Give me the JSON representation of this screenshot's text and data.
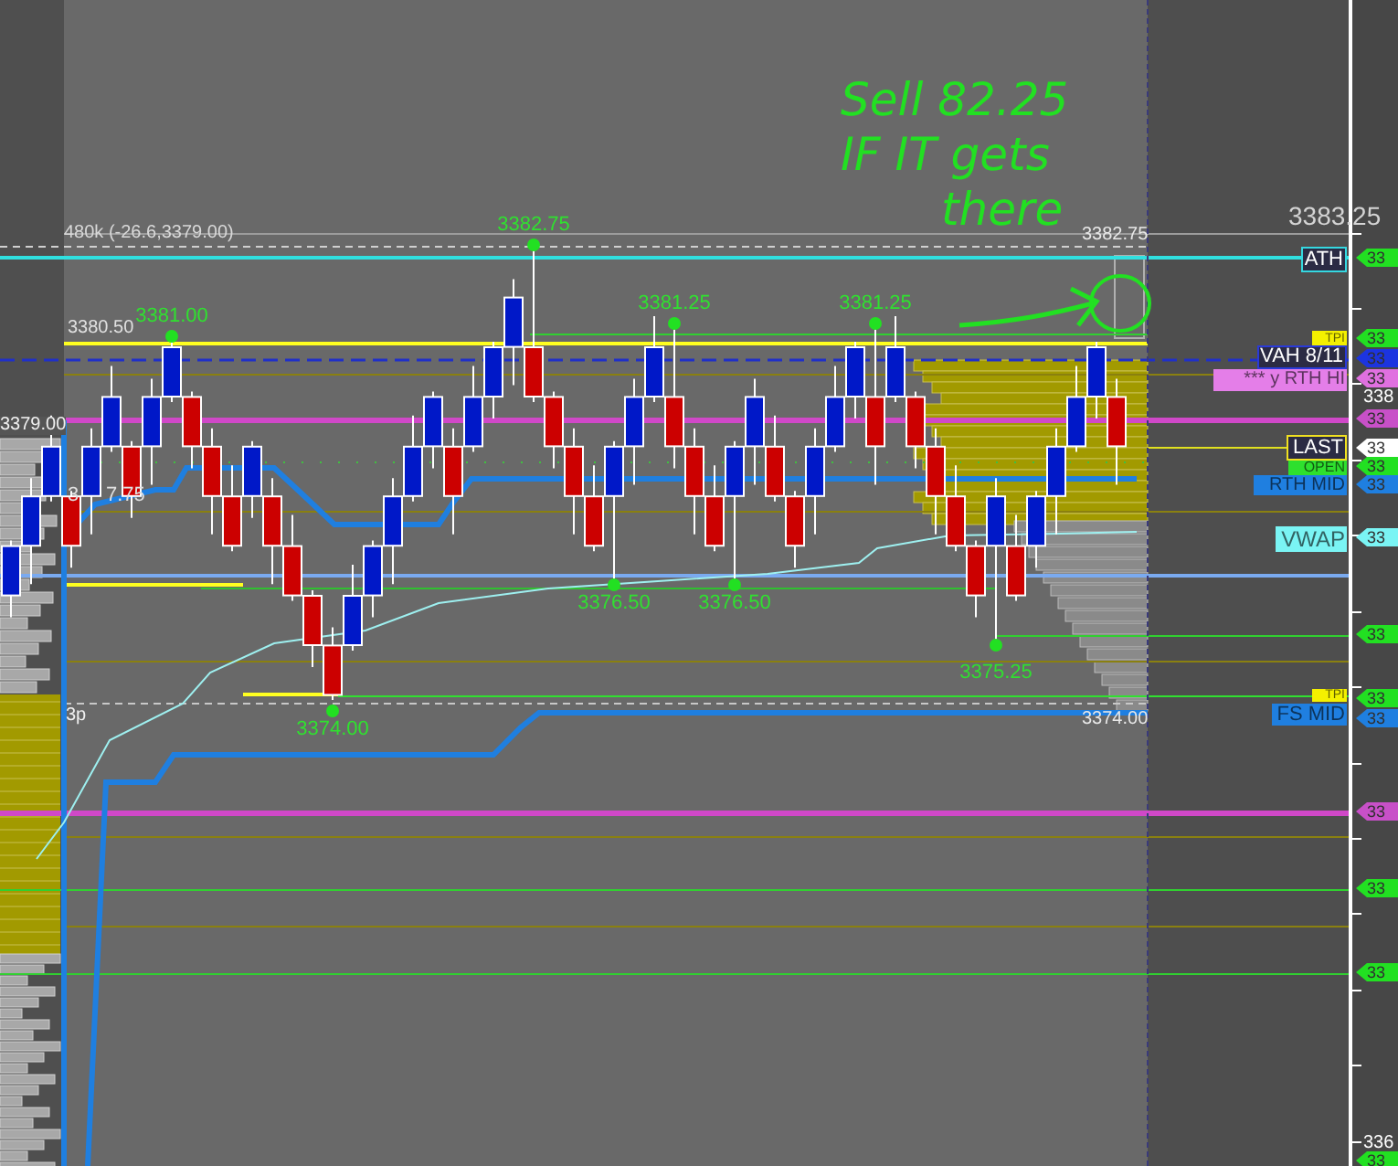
{
  "note": {
    "lines": [
      "Sell 82.25",
      "IF IT gets",
      "there"
    ]
  },
  "chart_texts": [
    "480k (-26.6,3379.00)",
    "3380.50",
    "3379.00",
    "3",
    "7.75",
    "3p",
    "3382.75",
    "3374.00"
  ],
  "price_markers": [
    "3382.75",
    "3381.00",
    "3381.25",
    "3381.25",
    "3376.50",
    "3376.50",
    "3375.25",
    "3374.00"
  ],
  "line_labels": [
    {
      "text": "ATH",
      "kind": "outline",
      "color": "#35d8e0"
    },
    {
      "text": "TPI",
      "kind": "filled",
      "color": "#f4f000"
    },
    {
      "text": "VAH 8/11",
      "kind": "outline",
      "color": "#2a3ad8"
    },
    {
      "text": "*** y RTH HI",
      "kind": "filled",
      "color": "#e47ee8"
    },
    {
      "text": "LAST",
      "kind": "outline",
      "color": "#f0e020"
    },
    {
      "text": "OPEN",
      "kind": "filled",
      "color": "#2ee02e"
    },
    {
      "text": "RTH MID",
      "kind": "filled",
      "color": "#1f7fe0"
    },
    {
      "text": "VWAP",
      "kind": "filled",
      "color": "#7af4f4"
    },
    {
      "text": "TPI",
      "kind": "filled",
      "color": "#f4f000"
    },
    {
      "text": "FS MID",
      "kind": "filled",
      "color": "#1f7fe0"
    }
  ],
  "axis": {
    "top_price": "3383.25",
    "ticks": [
      "338",
      "336"
    ]
  },
  "axis_tags": [
    {
      "text": "33",
      "color": "#22e022"
    },
    {
      "text": "33",
      "color": "#22e022"
    },
    {
      "text": "33",
      "color": "#1c34e0"
    },
    {
      "text": "33",
      "color": "#e070e0"
    },
    {
      "text": "33",
      "color": "#c850c8"
    },
    {
      "text": "33",
      "color": "#ffffff"
    },
    {
      "text": "33",
      "color": "#22e022"
    },
    {
      "text": "33",
      "color": "#1f7fe0"
    },
    {
      "text": "33",
      "color": "#7af4f4"
    },
    {
      "text": "33",
      "color": "#22e022"
    },
    {
      "text": "33",
      "color": "#22e022"
    },
    {
      "text": "33",
      "color": "#1f7fe0"
    },
    {
      "text": "33",
      "color": "#c850c8"
    },
    {
      "text": "33",
      "color": "#22e022"
    },
    {
      "text": "33",
      "color": "#22e022"
    },
    {
      "text": "33",
      "color": "#22e022"
    }
  ]
}
